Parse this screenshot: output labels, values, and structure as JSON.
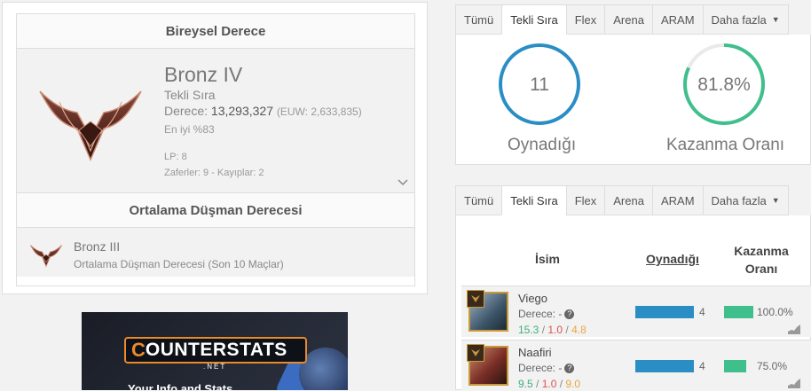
{
  "ranked": {
    "heading": "Bireysel Derece",
    "tier": "Bronz IV",
    "queue": "Tekli Sıra",
    "rank_label": "Derece:",
    "rank_value": "13,293,327",
    "rank_euw": "(EUW: 2,633,835)",
    "top_percent": "En iyi %83",
    "lp": "LP: 8",
    "wins_losses": "Zaferler: 9 - Kayıplar: 2",
    "chevron": "chevron-down-icon"
  },
  "avg_enemy": {
    "heading": "Ortalama Düşman Derecesi",
    "tier": "Bronz III",
    "subtitle": "Ortalama Düşman Derecesi (Son 10 Maçlar)"
  },
  "ad": {
    "logo_first": "C",
    "logo_rest": "OUNTERSTATS",
    "logo_net": ".NET",
    "tagline": "Your Info and Stats"
  },
  "tabs_top": [
    {
      "label": "Tümü",
      "active": false
    },
    {
      "label": "Tekli Sıra",
      "active": true
    },
    {
      "label": "Flex",
      "active": false
    },
    {
      "label": "Arena",
      "active": false
    },
    {
      "label": "ARAM",
      "active": false
    },
    {
      "label": "Daha fazla",
      "active": false,
      "dropdown": true
    }
  ],
  "tabs_bottom": [
    {
      "label": "Tümü",
      "active": false
    },
    {
      "label": "Tekli Sıra",
      "active": true
    },
    {
      "label": "Flex",
      "active": false
    },
    {
      "label": "Arena",
      "active": false
    },
    {
      "label": "ARAM",
      "active": false
    },
    {
      "label": "Daha fazla",
      "active": false,
      "dropdown": true
    }
  ],
  "stats": {
    "played_value": "11",
    "played_label": "Oynadığı",
    "winrate_value": "81.8%",
    "winrate_label": "Kazanma Oranı",
    "winrate_fraction": 0.818,
    "played_color": "#2a8ec4",
    "winrate_color": "#3fbf8c"
  },
  "champ_table": {
    "col_name": "İsim",
    "col_played": "Oynadığı",
    "col_winrate": "Kazanma Oranı",
    "rows": [
      {
        "name": "Viego",
        "rank": "Derece: -",
        "k": "15.3",
        "d": "1.0",
        "a": "4.8",
        "played": "4",
        "played_fraction": 1.0,
        "winrate": "100.0%",
        "winrate_fraction": 1.0
      },
      {
        "name": "Naafiri",
        "rank": "Derece: -",
        "k": "9.5",
        "d": "1.0",
        "a": "9.0",
        "played": "4",
        "played_fraction": 1.0,
        "winrate": "75.0%",
        "winrate_fraction": 0.75
      }
    ]
  }
}
